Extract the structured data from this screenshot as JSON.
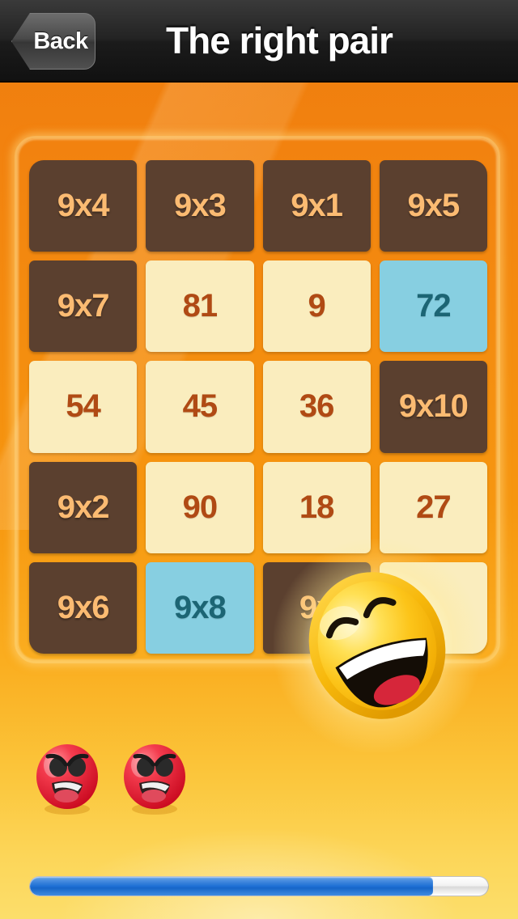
{
  "navbar": {
    "back_label": "Back",
    "title": "The right pair"
  },
  "colors": {
    "background_top": "#EE7D0E",
    "background_bottom": "#FCDE6B",
    "question_cell_bg": "#5B402F",
    "question_cell_text": "#FBBB72",
    "answer_cell_bg": "#FAEDBE",
    "answer_cell_text": "#B04A14",
    "selected_cell_bg": "#87CFE1",
    "selected_cell_text": "#1C6574",
    "progress_fill": "#1E6FD4",
    "progress_track": "#FFFFFF",
    "smiley_yellow": "#FCC21B",
    "angry_red": "#E8283C"
  },
  "grid": {
    "rows": 5,
    "cols": 4,
    "cells": [
      {
        "label": "9x4",
        "state": "question",
        "covered": false
      },
      {
        "label": "9x3",
        "state": "question",
        "covered": false
      },
      {
        "label": "9x1",
        "state": "question",
        "covered": false
      },
      {
        "label": "9x5",
        "state": "question",
        "covered": false
      },
      {
        "label": "9x7",
        "state": "question",
        "covered": false
      },
      {
        "label": "81",
        "state": "answer",
        "covered": false
      },
      {
        "label": "9",
        "state": "answer",
        "covered": false
      },
      {
        "label": "72",
        "state": "selected",
        "covered": false
      },
      {
        "label": "54",
        "state": "answer",
        "covered": false
      },
      {
        "label": "45",
        "state": "answer",
        "covered": false
      },
      {
        "label": "36",
        "state": "answer",
        "covered": false
      },
      {
        "label": "9x10",
        "state": "question",
        "covered": false
      },
      {
        "label": "9x2",
        "state": "question",
        "covered": false
      },
      {
        "label": "90",
        "state": "answer",
        "covered": false
      },
      {
        "label": "18",
        "state": "answer",
        "covered": false
      },
      {
        "label": "27",
        "state": "answer",
        "covered": false
      },
      {
        "label": "9x6",
        "state": "question",
        "covered": false
      },
      {
        "label": "9x8",
        "state": "selected",
        "covered": false
      },
      {
        "label": "9x",
        "state": "question",
        "covered": true
      },
      {
        "label": "",
        "state": "answer",
        "covered": true
      }
    ]
  },
  "feedback": {
    "happy_icon": "laughing-smiley-icon",
    "mistake_icon": "angry-face-icon",
    "mistakes_count": 2
  },
  "progress": {
    "percent": 88,
    "label": "88%"
  }
}
